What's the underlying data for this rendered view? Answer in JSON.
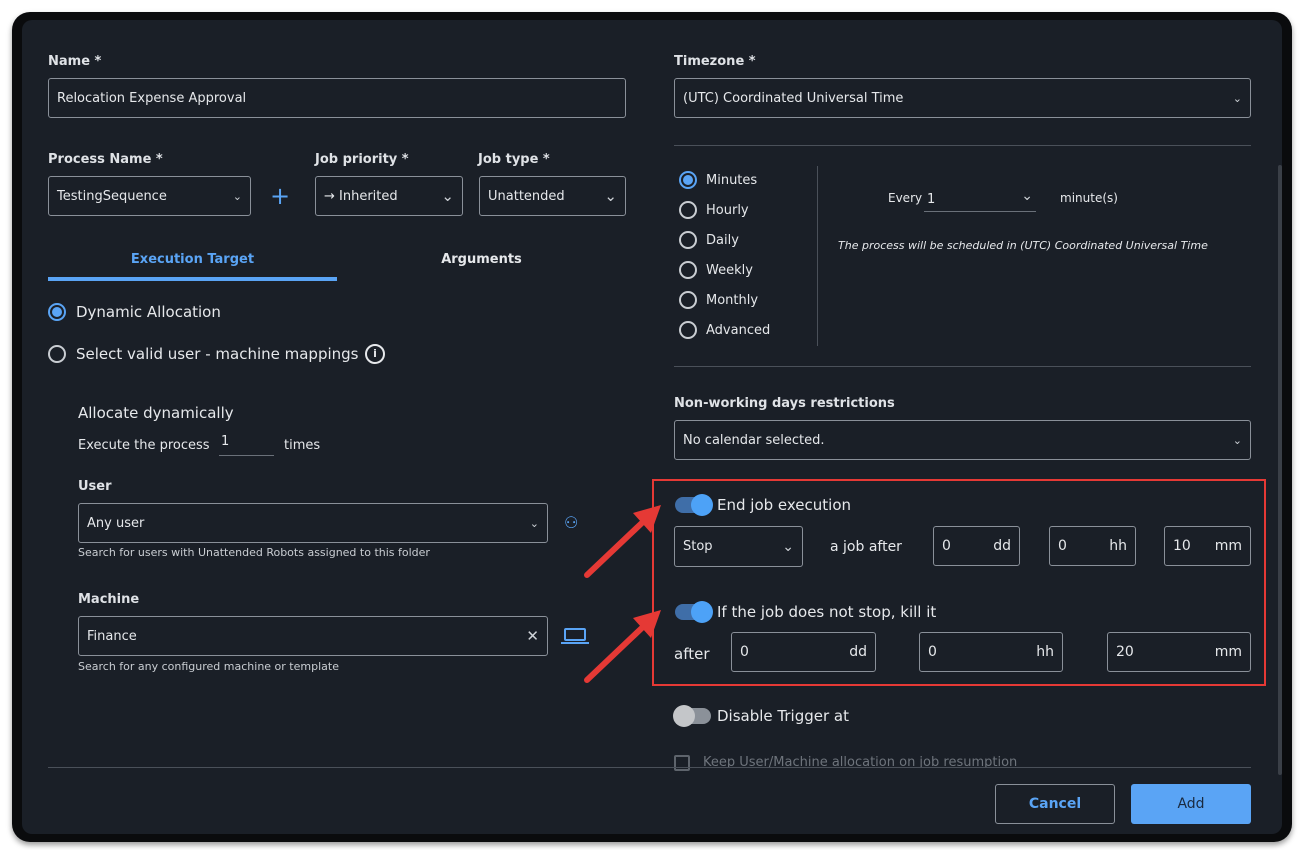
{
  "name": {
    "label": "Name *",
    "value": "Relocation Expense Approval"
  },
  "process": {
    "label": "Process Name *",
    "value": "TestingSequence",
    "add": "+"
  },
  "priority": {
    "label": "Job priority *",
    "value": "→ Inherited"
  },
  "jobtype": {
    "label": "Job type *",
    "value": "Unattended"
  },
  "tabs": [
    {
      "label": "Execution Target",
      "active": true
    },
    {
      "label": "Arguments"
    }
  ],
  "allocation": {
    "dynamic": "Dynamic Allocation",
    "mappings": "Select valid user - machine mappings",
    "selected": "dynamic"
  },
  "alloc_dyn": {
    "title": "Allocate dynamically",
    "execute_prefix": "Execute the process",
    "count": "1",
    "execute_suffix": "times"
  },
  "user": {
    "label": "User",
    "value": "Any user",
    "hint": "Search for users with Unattended Robots assigned to this folder"
  },
  "machine": {
    "label": "Machine",
    "value": "Finance",
    "hint": "Search for any configured machine or template"
  },
  "timezone": {
    "label": "Timezone *",
    "value": "(UTC) Coordinated Universal Time"
  },
  "frequency": {
    "options": [
      "Minutes",
      "Hourly",
      "Daily",
      "Weekly",
      "Monthly",
      "Advanced"
    ],
    "selected": "Minutes"
  },
  "every": {
    "label": "Every",
    "value": "1",
    "unit": "minute(s)",
    "note": "The process will be scheduled in (UTC) Coordinated Universal Time"
  },
  "calendar": {
    "label": "Non-working days restrictions",
    "value": "No calendar selected."
  },
  "end_job": {
    "label": "End job execution",
    "enabled": true,
    "action": "Stop",
    "after": "a job after",
    "dd": "0",
    "hh": "0",
    "mm": "10"
  },
  "kill": {
    "label": "If the job does not stop, kill it",
    "enabled": true,
    "after": "after",
    "dd": "0",
    "hh": "0",
    "mm": "20"
  },
  "units": {
    "dd": "dd",
    "hh": "hh",
    "mm": "mm"
  },
  "disable": {
    "label": "Disable Trigger at",
    "enabled": false
  },
  "keep": {
    "label": "Keep User/Machine allocation on job resumption"
  },
  "buttons": {
    "cancel": "Cancel",
    "add": "Add"
  },
  "colors": {
    "accent": "#5aa4f5",
    "highlight": "#e53935",
    "background": "#1a1f27"
  }
}
